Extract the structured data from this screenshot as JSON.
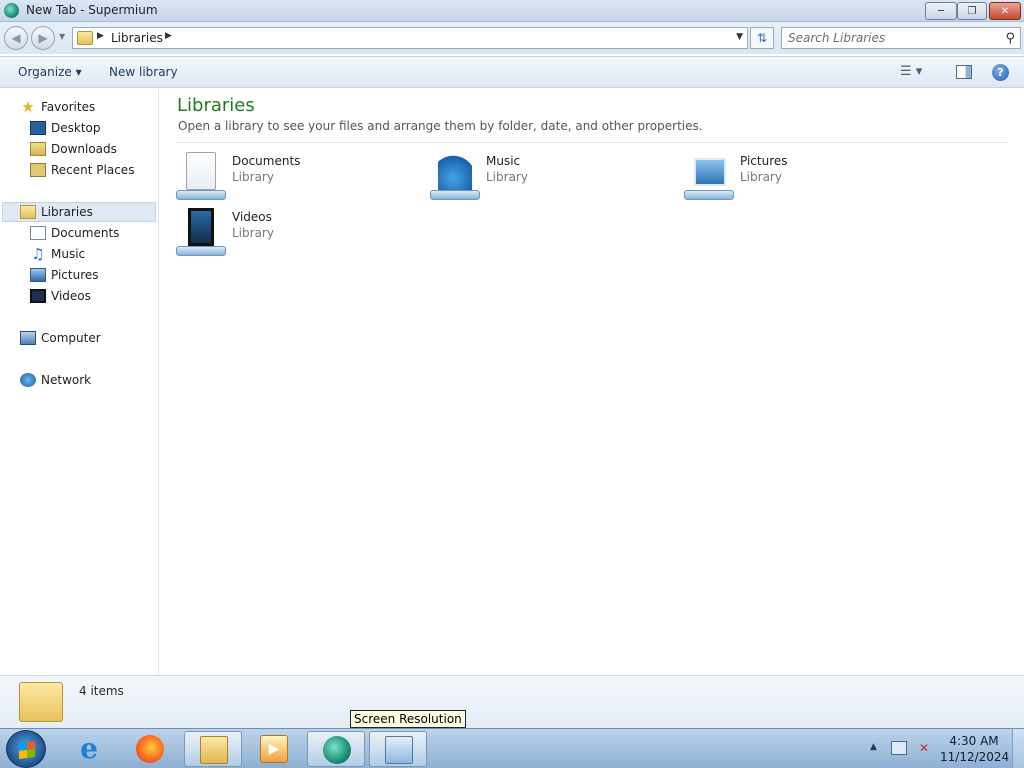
{
  "window": {
    "title": "New Tab - Supermium"
  },
  "address": {
    "crumb": "Libraries",
    "search_placeholder": "Search Libraries"
  },
  "toolbar": {
    "organize": "Organize",
    "new_library": "New library"
  },
  "nav": {
    "favorites": "Favorites",
    "desktop": "Desktop",
    "downloads": "Downloads",
    "recent": "Recent Places",
    "libraries": "Libraries",
    "documents": "Documents",
    "music": "Music",
    "pictures": "Pictures",
    "videos": "Videos",
    "computer": "Computer",
    "network": "Network"
  },
  "main": {
    "heading": "Libraries",
    "subtitle": "Open a library to see your files and arrange them by folder, date, and other properties.",
    "libraries": [
      {
        "name": "Documents",
        "kind": "Library",
        "icon": "documents-library-icon"
      },
      {
        "name": "Music",
        "kind": "Library",
        "icon": "music-library-icon"
      },
      {
        "name": "Pictures",
        "kind": "Library",
        "icon": "pictures-library-icon"
      },
      {
        "name": "Videos",
        "kind": "Library",
        "icon": "videos-library-icon"
      }
    ]
  },
  "details": {
    "count": "4 items"
  },
  "tooltip": "Screen Resolution",
  "taskbar": {
    "time": "4:30 AM",
    "date": "11/12/2024",
    "apps": [
      "internet-explorer-icon",
      "firefox-icon",
      "windows-explorer-icon",
      "media-player-icon",
      "supermium-icon",
      "screen-resolution-icon"
    ]
  },
  "colors": {
    "heading_green": "#1e7b1e",
    "selection": "#dfe9f5"
  }
}
